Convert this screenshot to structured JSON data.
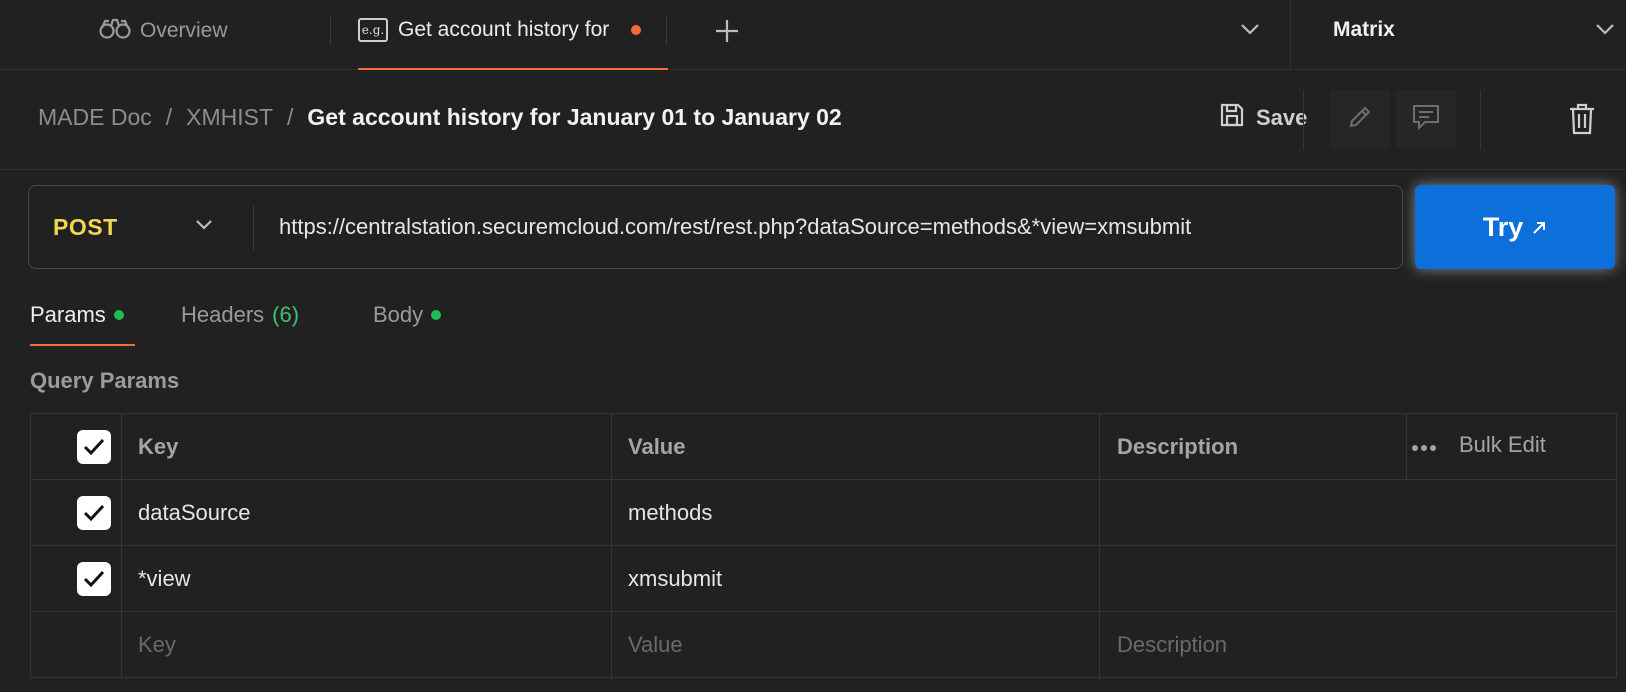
{
  "tabs": {
    "overview_label": "Overview",
    "active_label": "Get account history for"
  },
  "environment": {
    "name": "Matrix"
  },
  "breadcrumb": {
    "items": [
      "MADE Doc",
      "XMHIST",
      "Get account history for January 01 to January 02"
    ],
    "separator": "/"
  },
  "header": {
    "save_label": "Save"
  },
  "request": {
    "method": "POST",
    "url": "https://centralstation.securemcloud.com/rest/rest.php?dataSource=methods&*view=xmsubmit",
    "try_label": "Try"
  },
  "subtabs": {
    "params": "Params",
    "headers": "Headers",
    "headers_count": "(6)",
    "body": "Body"
  },
  "query_params": {
    "title": "Query Params",
    "columns": {
      "key": "Key",
      "value": "Value",
      "description": "Description"
    },
    "bulk_edit_label": "Bulk Edit",
    "rows": [
      {
        "key": "dataSource",
        "value": "methods",
        "description": "",
        "checked": true
      },
      {
        "key": "*view",
        "value": "xmsubmit",
        "description": "",
        "checked": true
      }
    ],
    "placeholders": {
      "key": "Key",
      "value": "Value",
      "description": "Description"
    }
  },
  "colors": {
    "accent": "#f26b3a",
    "method": "#f0d74e",
    "primary_button": "#0d6fd9",
    "active_dot": "#1ebb55"
  },
  "icons": {
    "overview": "binoculars-icon",
    "request_tab": "eg-example-icon",
    "new_tab": "plus-icon",
    "dropdown": "chevron-down-icon",
    "save": "floppy-disk-icon",
    "edit": "pencil-icon",
    "comment": "comment-icon",
    "delete": "trash-icon",
    "try": "arrow-up-right-icon",
    "check": "checkmark-icon",
    "more": "ellipsis-icon"
  }
}
